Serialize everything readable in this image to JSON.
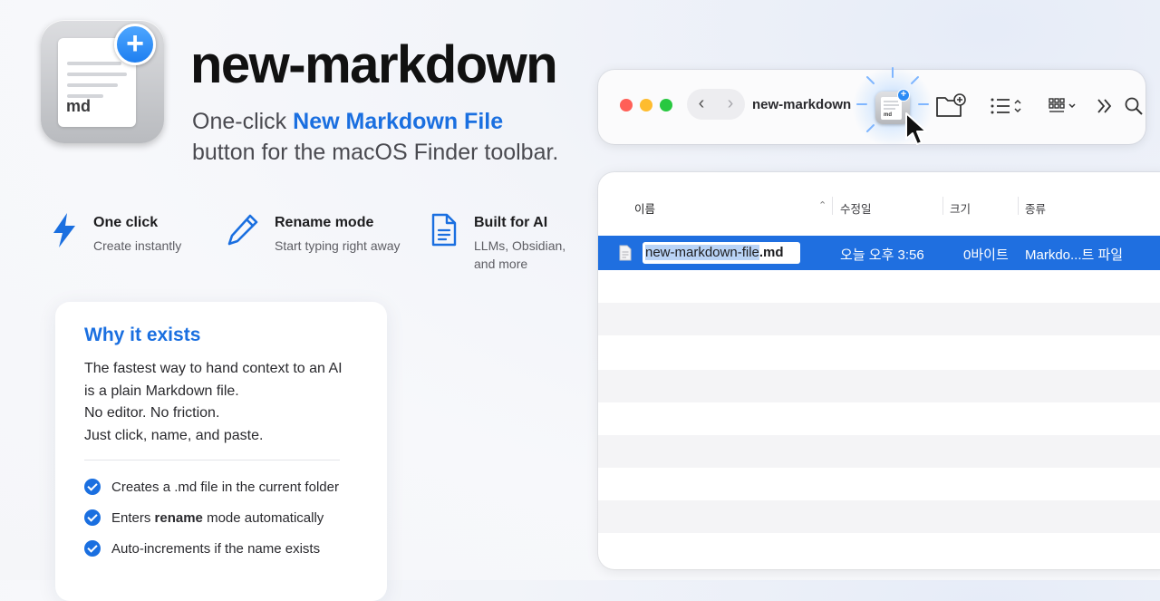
{
  "hero": {
    "title": "new-markdown",
    "app_icon_text": "md",
    "subtitle_prefix": "One-click ",
    "subtitle_highlight": "New Markdown File",
    "subtitle_line2": "button for the macOS Finder toolbar."
  },
  "features": [
    {
      "icon": "lightning-icon",
      "name": "One click",
      "desc": [
        "Create instantly"
      ]
    },
    {
      "icon": "pencil-icon",
      "name": "Rename mode",
      "desc": [
        "Start typing right away"
      ]
    },
    {
      "icon": "document-icon",
      "name": "Built for AI",
      "desc": [
        "LLMs, Obsidian,",
        "and more"
      ]
    }
  ],
  "why": {
    "title": "Why it exists",
    "body": [
      "The fastest way to hand context to an AI",
      "is a plain Markdown file.",
      "No editor. No friction.",
      "Just click, name, and paste."
    ],
    "checks": [
      {
        "before": "Creates a .md file in the current folder",
        "bold": "",
        "after": ""
      },
      {
        "before": "Enters ",
        "bold": "rename",
        "after": " mode automatically"
      },
      {
        "before": "Auto-increments if the name exists",
        "bold": "",
        "after": ""
      }
    ]
  },
  "finder": {
    "folder_title": "new-markdown",
    "toolbar_icon_text": "md",
    "traffic_colors": {
      "close": "#ff5f57",
      "minimize": "#febc2e",
      "zoom": "#28c840"
    },
    "accent": "#1f6fe0",
    "columns": {
      "name": "이름",
      "modified": "수정일",
      "size": "크기",
      "kind": "종류"
    },
    "selected_row": {
      "filename_stem": "new-markdown-file",
      "filename_ext": ".md",
      "modified": "오늘 오후 3:56",
      "size": "0바이트",
      "kind": "Markdo...트 파일"
    }
  }
}
